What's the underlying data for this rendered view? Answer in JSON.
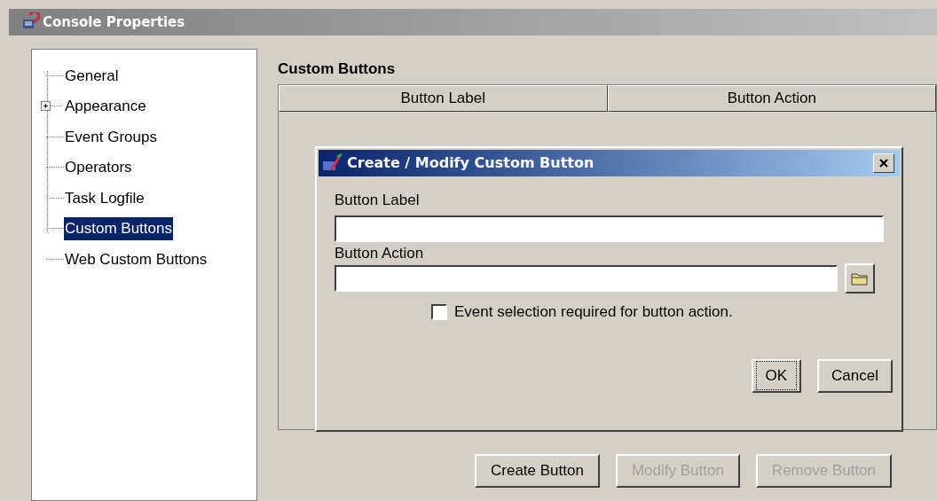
{
  "window": {
    "title": "Console Properties"
  },
  "tree": [
    {
      "label": "General",
      "kind": "leaf",
      "selected": false
    },
    {
      "label": "Appearance",
      "kind": "collapsed",
      "selected": false
    },
    {
      "label": "Event Groups",
      "kind": "leaf",
      "selected": false
    },
    {
      "label": "Operators",
      "kind": "leaf",
      "selected": false
    },
    {
      "label": "Task Logfile",
      "kind": "leaf",
      "selected": false
    },
    {
      "label": "Custom Buttons",
      "kind": "leaf",
      "selected": true
    },
    {
      "label": "Web Custom Buttons",
      "kind": "leaf",
      "selected": false
    }
  ],
  "section_title": "Custom Buttons",
  "table": {
    "columns": [
      "Button Label",
      "Button Action"
    ]
  },
  "dialog": {
    "title": "Create / Modify Custom Button",
    "fields": [
      {
        "label": "Button Label",
        "kind": "text"
      },
      {
        "label": "Button Action",
        "kind": "browse"
      }
    ],
    "checkbox": {
      "label": "Event selection required for button action.",
      "checked": false
    },
    "buttons": [
      {
        "label": "OK",
        "focused": true
      },
      {
        "label": "Cancel",
        "focused": false
      }
    ]
  },
  "buttons": [
    {
      "label": "Create Button",
      "disabled": false
    },
    {
      "label": "Modify Button",
      "disabled": true
    },
    {
      "label": "Remove Button",
      "disabled": true
    }
  ]
}
